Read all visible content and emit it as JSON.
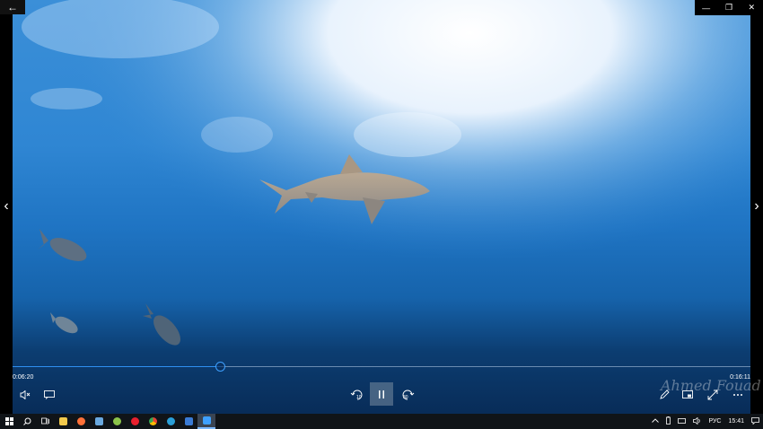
{
  "player": {
    "elapsed": "0:06:20",
    "total": "0:16:11",
    "progress_fraction": 0.282,
    "watermark": "Ahmed Fouad"
  },
  "icons": {
    "back": "back-arrow-icon",
    "minimize": "minimize-icon",
    "restore": "restore-icon",
    "close": "close-icon",
    "prev": "chevron-left-icon",
    "next": "chevron-right-icon",
    "mute": "volume-mute-icon",
    "subtitles": "subtitles-icon",
    "skip_back": "skip-back-10-icon",
    "pause": "pause-icon",
    "skip_forward": "skip-forward-30-icon",
    "edit": "pen-icon",
    "mini_view": "mini-view-icon",
    "fullscreen": "fullscreen-icon",
    "more": "more-icon"
  },
  "skip": {
    "back": "10",
    "forward": "30"
  },
  "window": {
    "back": "←",
    "minimize": "—",
    "restore": "❐",
    "close": "✕",
    "prev": "‹",
    "next": "›"
  },
  "taskbar": {
    "apps": [
      "start",
      "search",
      "task-view",
      "file-explorer",
      "firefox",
      "app",
      "app",
      "opera",
      "chrome",
      "edge",
      "app",
      "app",
      "movies-tv"
    ],
    "language": "РУС",
    "clock": "15:41"
  },
  "colors": {
    "accent": "#3ea0ff",
    "taskbar": "#101418"
  }
}
